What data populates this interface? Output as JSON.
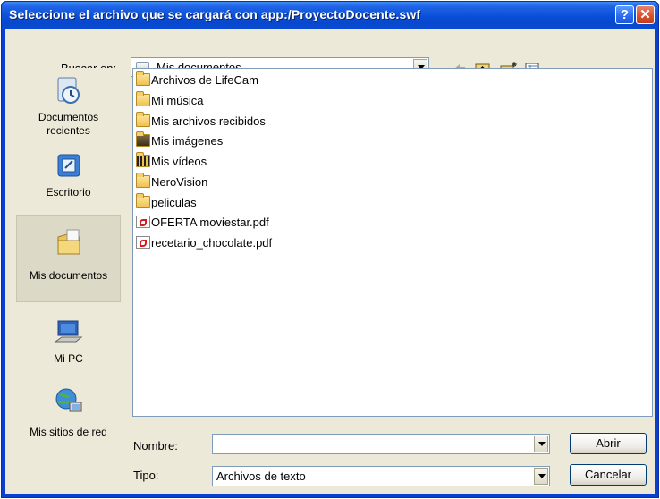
{
  "window": {
    "title": "Seleccione el archivo que se cargará con app:/ProyectoDocente.swf",
    "help_glyph": "?",
    "close_glyph": "✕"
  },
  "lookin": {
    "label": "Buscar en:",
    "value": "Mis documentos",
    "icon": "my-documents-icon"
  },
  "toolbar": {
    "back_icon": "back-arrow-icon",
    "up_icon": "up-folder-icon",
    "new_folder_icon": "new-folder-icon",
    "views_icon": "views-menu-icon"
  },
  "places": [
    {
      "label_line1": "Documentos",
      "label_line2": "recientes",
      "icon": "recent-documents-icon"
    },
    {
      "label_line1": "Escritorio",
      "label_line2": "",
      "icon": "desktop-icon"
    },
    {
      "label_line1": "Mis documentos",
      "label_line2": "",
      "icon": "my-documents-folder-icon",
      "selected": true
    },
    {
      "label_line1": "Mi PC",
      "label_line2": "",
      "icon": "my-computer-icon"
    },
    {
      "label_line1": "Mis sitios de red",
      "label_line2": "",
      "icon": "network-places-icon"
    }
  ],
  "files": [
    {
      "name": "Archivos de LifeCam",
      "icon": "folder-icon"
    },
    {
      "name": "Mi música",
      "icon": "music-folder-icon"
    },
    {
      "name": "Mis archivos recibidos",
      "icon": "folder-icon"
    },
    {
      "name": "Mis imágenes",
      "icon": "pictures-folder-icon"
    },
    {
      "name": "Mis vídeos",
      "icon": "videos-folder-icon"
    },
    {
      "name": "NeroVision",
      "icon": "folder-icon"
    },
    {
      "name": "peliculas",
      "icon": "folder-icon"
    },
    {
      "name": "OFERTA moviestar.pdf",
      "icon": "pdf-file-icon"
    },
    {
      "name": "recetario_chocolate.pdf",
      "icon": "pdf-file-icon"
    }
  ],
  "filename": {
    "label": "Nombre:",
    "value": ""
  },
  "filetype": {
    "label": "Tipo:",
    "value": "Archivos de texto"
  },
  "buttons": {
    "open": "Abrir",
    "cancel": "Cancelar"
  }
}
